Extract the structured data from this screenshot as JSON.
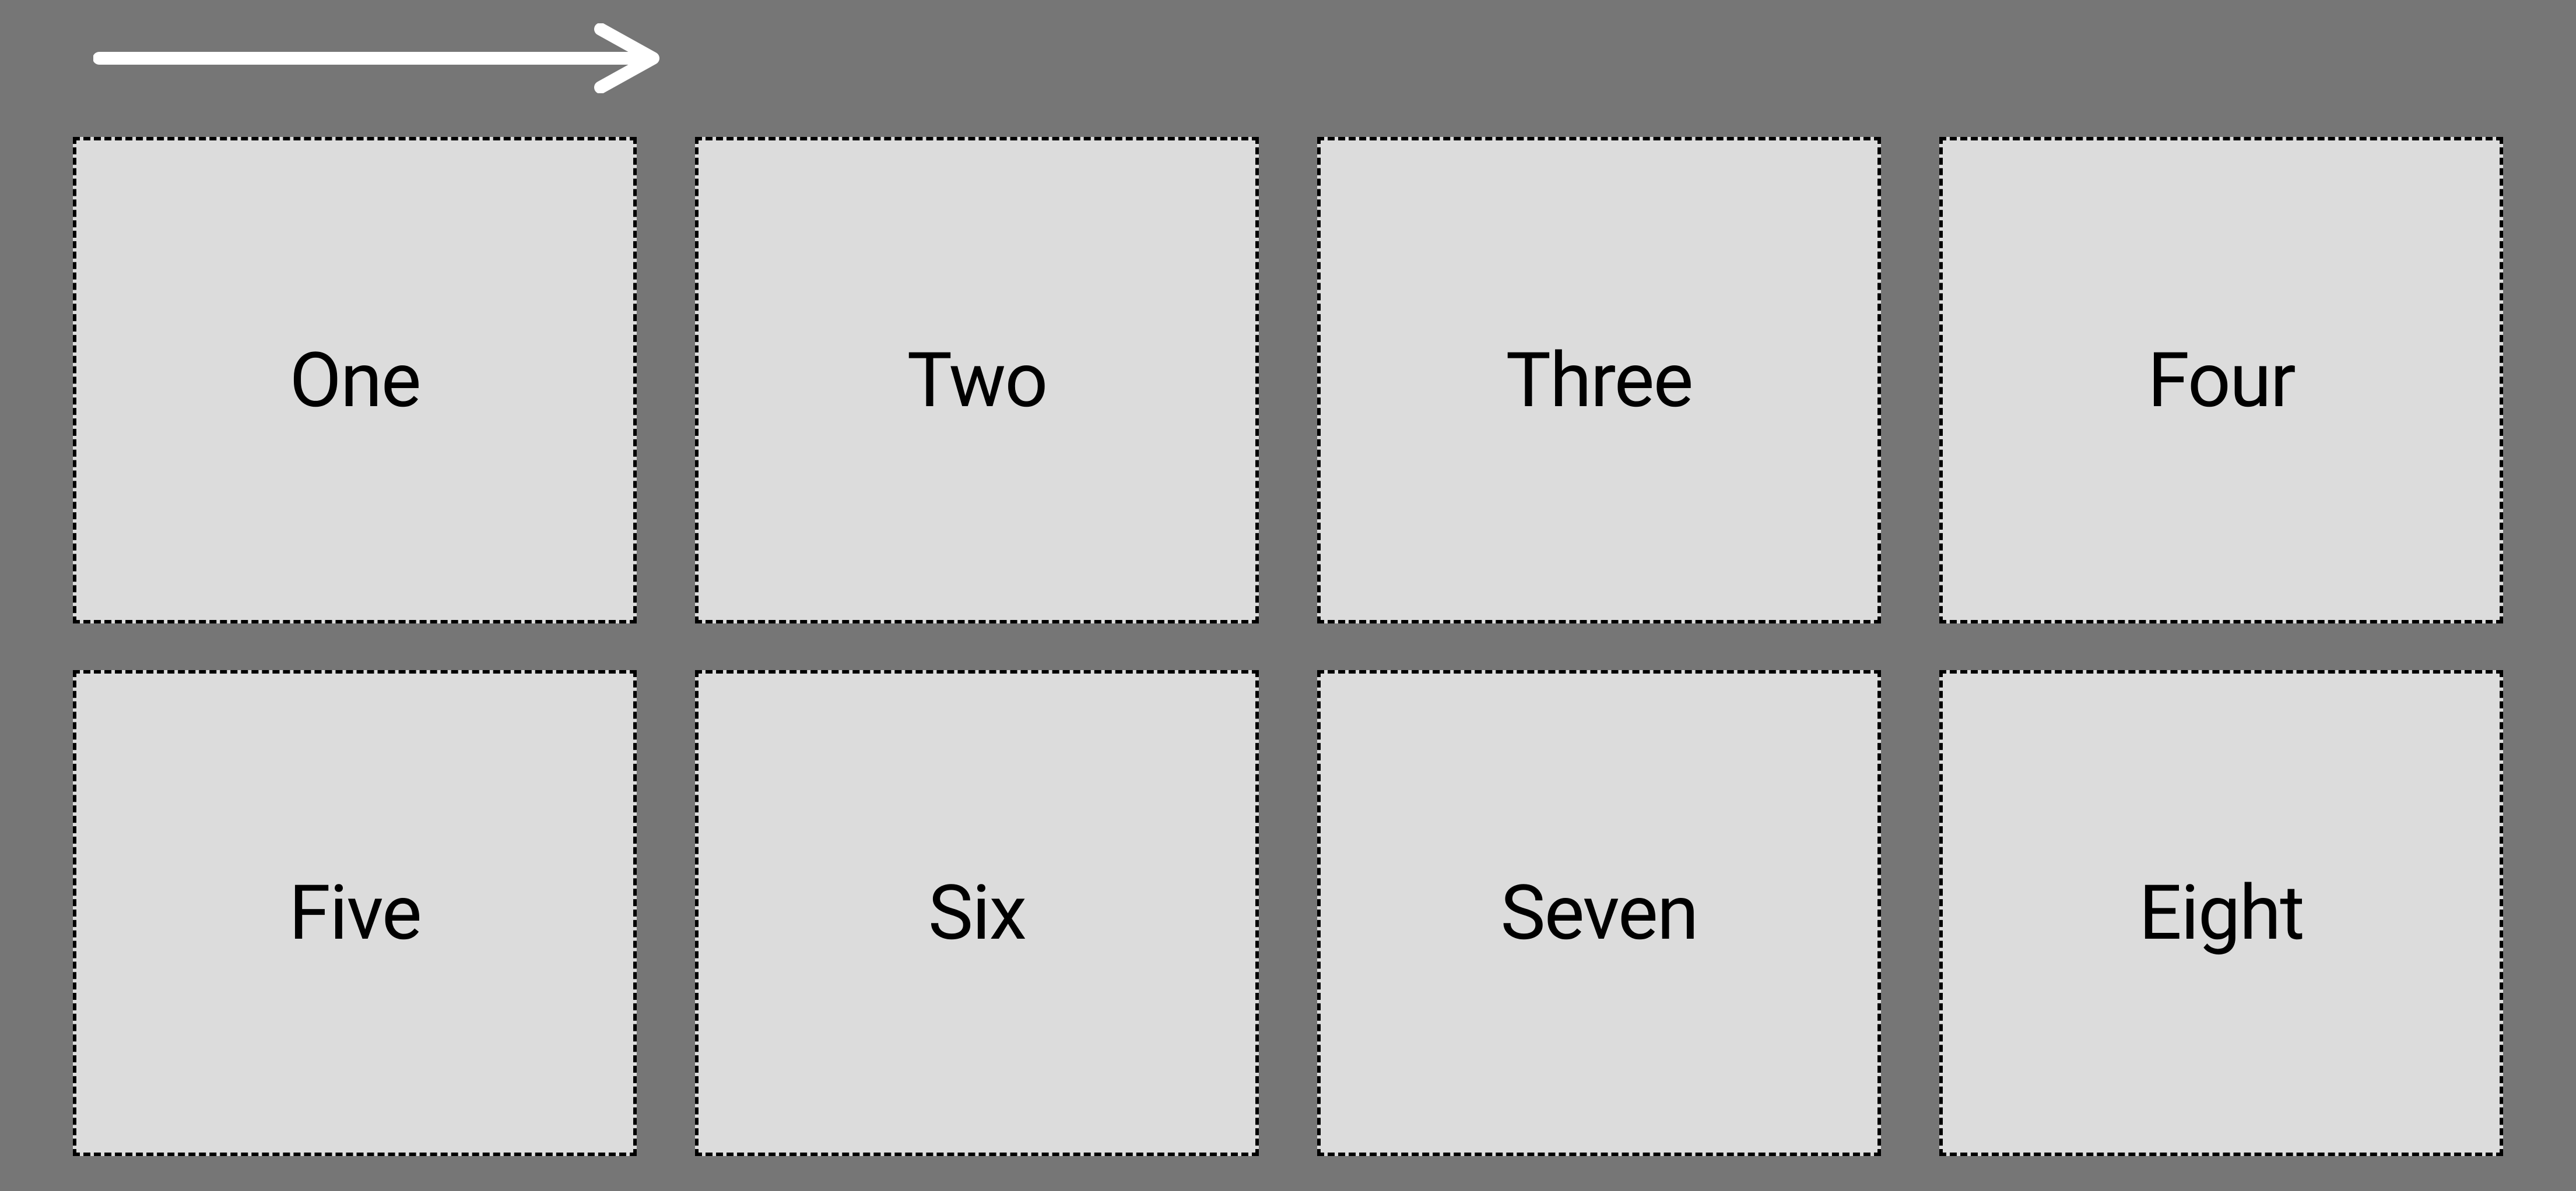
{
  "cells": [
    {
      "label": "One"
    },
    {
      "label": "Two"
    },
    {
      "label": "Three"
    },
    {
      "label": "Four"
    },
    {
      "label": "Five"
    },
    {
      "label": "Six"
    },
    {
      "label": "Seven"
    },
    {
      "label": "Eight"
    }
  ],
  "direction": "row",
  "colors": {
    "background": "#767676",
    "cell_background": "#dcdcdc",
    "cell_border": "#000000",
    "arrow": "#ffffff"
  }
}
